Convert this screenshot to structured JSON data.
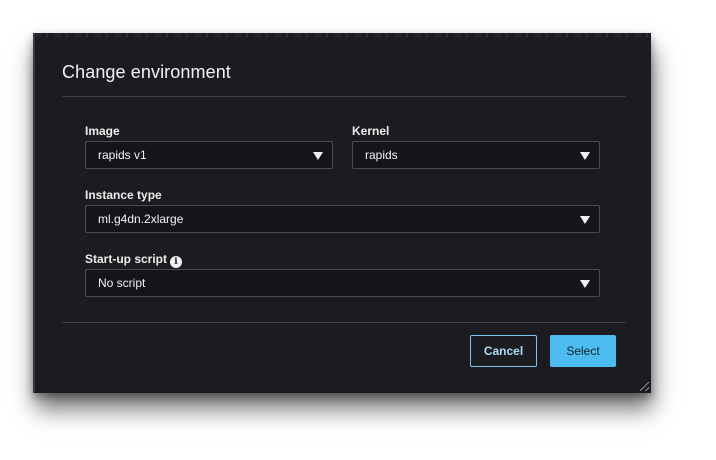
{
  "dialog": {
    "title": "Change environment",
    "fields": {
      "image": {
        "label": "Image",
        "value": "rapids v1"
      },
      "kernel": {
        "label": "Kernel",
        "value": "rapids"
      },
      "instance_type": {
        "label": "Instance type",
        "value": "ml.g4dn.2xlarge"
      },
      "startup_script": {
        "label": "Start-up script",
        "value": "No script",
        "info_icon": "info-icon"
      }
    },
    "buttons": {
      "cancel": "Cancel",
      "select": "Select"
    }
  },
  "colors": {
    "background": "#1b1c20",
    "input_bg": "#141519",
    "accent": "#4cbcf1",
    "text": "#f2f3f3"
  }
}
